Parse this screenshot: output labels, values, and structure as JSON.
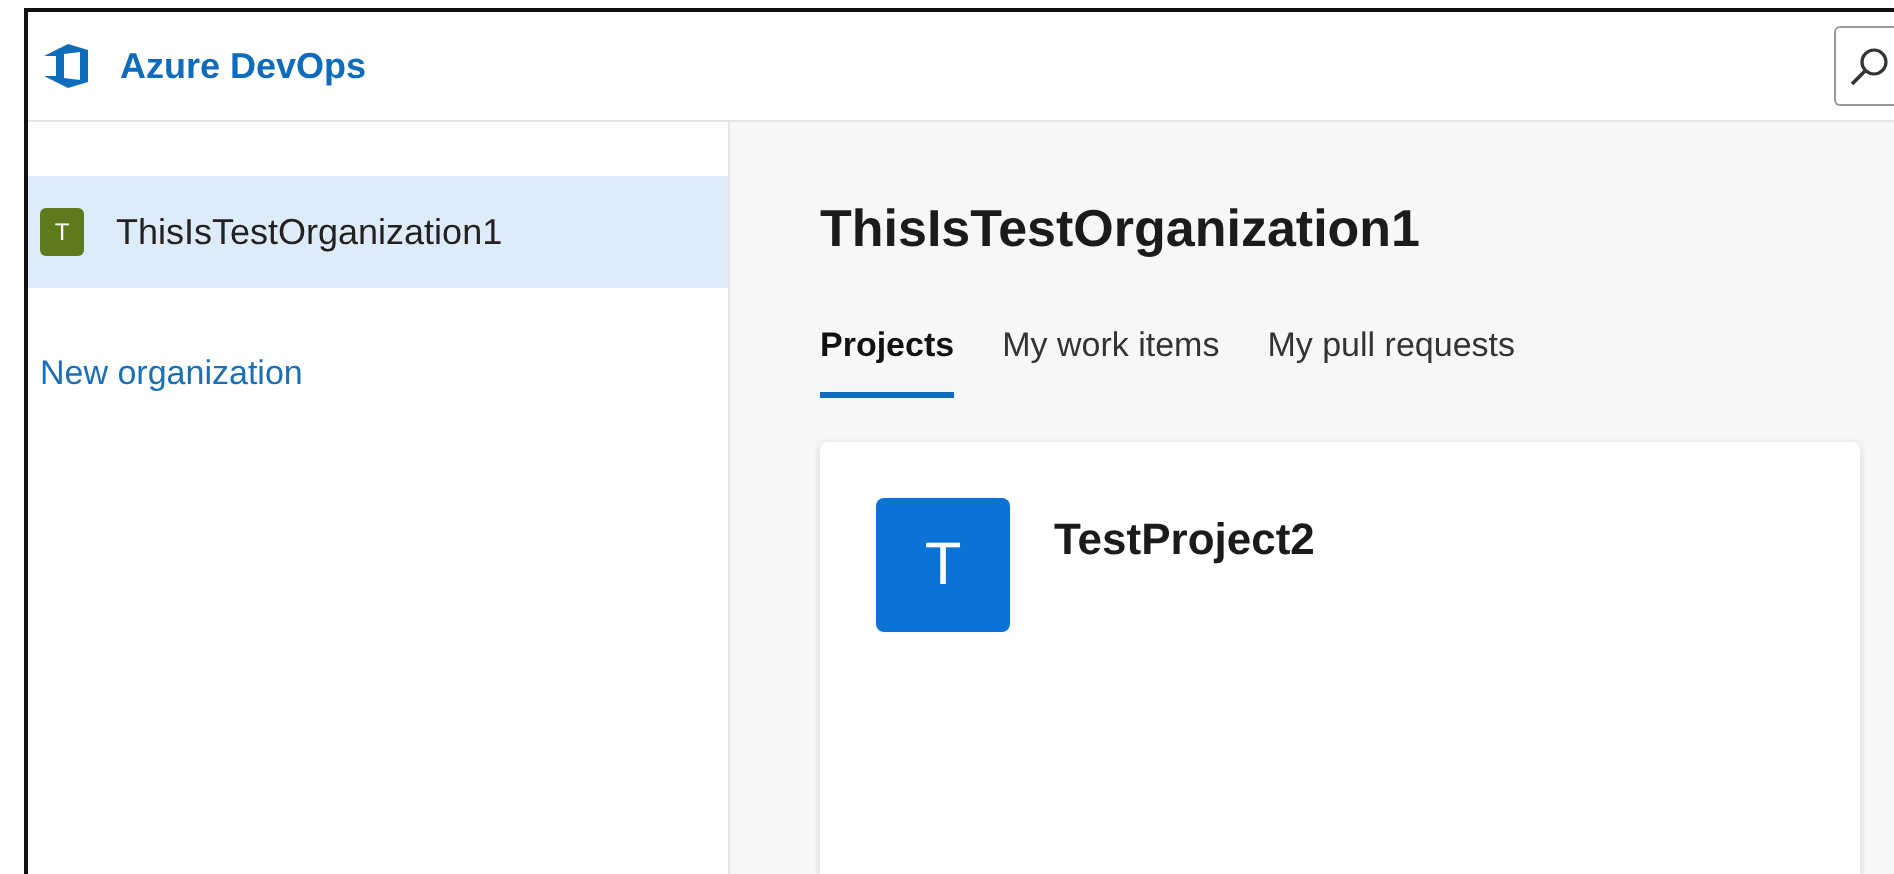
{
  "header": {
    "brand": "Azure DevOps"
  },
  "sidebar": {
    "organizations": [
      {
        "name": "ThisIsTestOrganization1",
        "avatar": "T",
        "selected": true
      }
    ],
    "new_link": "New organization"
  },
  "main": {
    "title": "ThisIsTestOrganization1",
    "tabs": [
      {
        "label": "Projects",
        "selected": true
      },
      {
        "label": "My work items",
        "selected": false
      },
      {
        "label": "My pull requests",
        "selected": false
      }
    ],
    "projects": [
      {
        "name": "TestProject2",
        "avatar": "T"
      }
    ]
  }
}
